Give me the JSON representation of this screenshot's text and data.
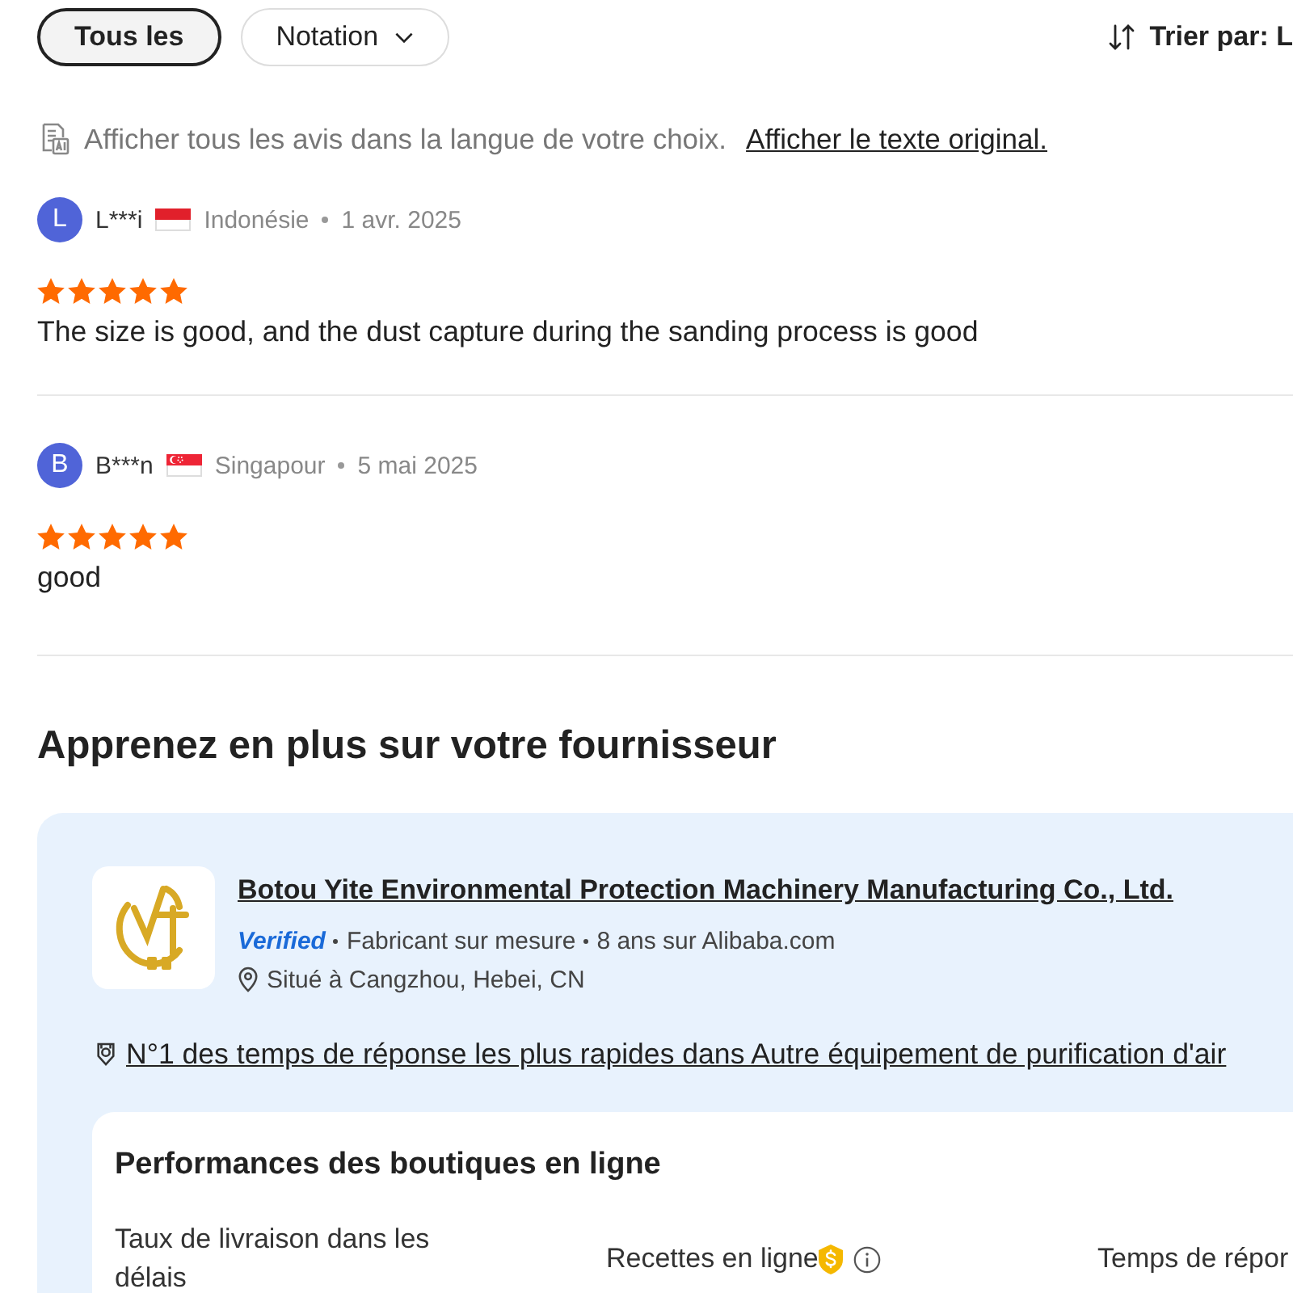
{
  "filters": [
    {
      "kind": "chip",
      "label": "Tous les",
      "selected": true
    },
    {
      "kind": "dropdown",
      "label": "Notation",
      "selected": false
    }
  ],
  "sort": {
    "label": "Trier par: L"
  },
  "translation": {
    "text": "Afficher tous les avis dans la langue de votre choix.",
    "link": "Afficher le texte original."
  },
  "reviews": [
    {
      "initial": "L",
      "name": "L***i",
      "kind": "indonesia",
      "country": "Indonésie",
      "date": "1 avr. 2025",
      "stars": 5,
      "text": "The size is good, and the dust capture during the sanding process is good"
    },
    {
      "initial": "B",
      "name": "B***n",
      "kind": "singapore",
      "country": "Singapour",
      "date": "5 mai 2025",
      "stars": 5,
      "text": "good"
    }
  ],
  "supplier": {
    "heading": "Apprenez en plus sur votre fournisseur",
    "name": "Botou Yite Environmental Protection Machinery Manufacturing Co., Ltd.",
    "verified": "Verified",
    "details": [
      "Fabricant sur mesure",
      "8 ans sur Alibaba.com"
    ],
    "location": "Situé à Cangzhou, Hebei, CN",
    "ranking": "N°1 des temps de réponse les plus rapides dans Autre équipement de purification d'air",
    "performance": {
      "title": "Performances des boutiques en ligne",
      "metrics": [
        {
          "label": "Taux de livraison dans les délais",
          "badge": false,
          "info": false
        },
        {
          "label": "Recettes en ligne",
          "badge": true,
          "info": true
        },
        {
          "label": "Temps de répor",
          "badge": false,
          "info": false
        }
      ]
    }
  }
}
